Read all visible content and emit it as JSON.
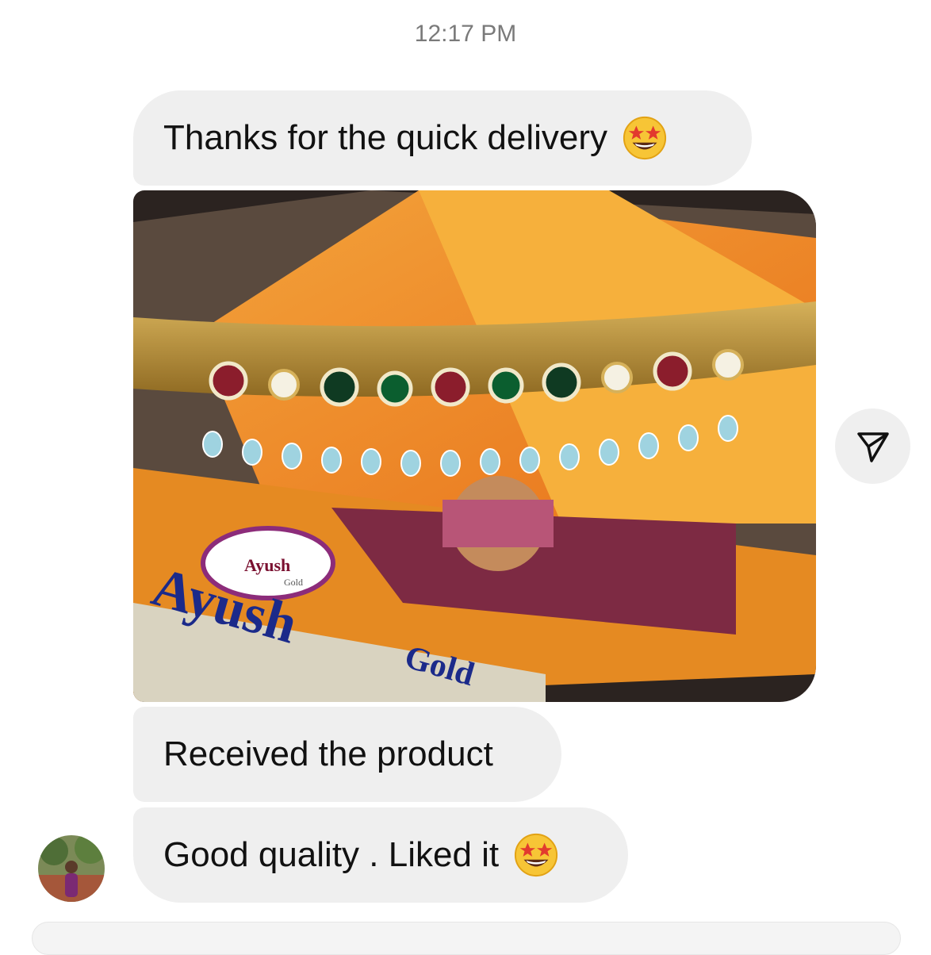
{
  "thread": {
    "timestamp": "12:17 PM",
    "messages": [
      {
        "text": "Thanks for the quick delivery",
        "emoji": "star-struck-emoji"
      },
      {
        "type": "photo",
        "subject": "jewellery-box-photo",
        "box_brand": "Ayush",
        "box_brand_small": "Gold",
        "box_brand_large": "Ayush",
        "box_brand_suffix": "Gold"
      },
      {
        "text": "Received the product"
      },
      {
        "text": "Good quality . Liked it",
        "emoji": "star-struck-emoji"
      }
    ]
  },
  "icons": {
    "share": "paper-plane-icon",
    "avatar": "profile-avatar"
  },
  "colors": {
    "bubble": "#efefef",
    "timestamp": "#7a7a7a",
    "text": "#111111"
  }
}
